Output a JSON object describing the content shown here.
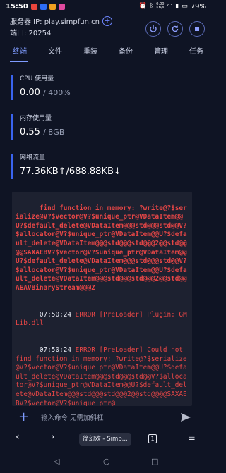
{
  "status_bar": {
    "time": "15:50",
    "net_speed": "0.00\nKB/s",
    "battery": "79%",
    "icon_colors": [
      "#e8453c",
      "#2d6cf5",
      "#f0a020",
      "#e04aa0"
    ]
  },
  "header": {
    "server_label": "服务器 IP: play.simpfun.cn",
    "port_label": "端口: 20254"
  },
  "tabs": [
    {
      "label": "终端",
      "active": true
    },
    {
      "label": "文件"
    },
    {
      "label": "重装"
    },
    {
      "label": "备份"
    },
    {
      "label": "管理"
    },
    {
      "label": "任务"
    }
  ],
  "metrics": {
    "cpu": {
      "title": "CPU 使用量",
      "value": "0.00",
      "limit": "/ 400%"
    },
    "memory": {
      "title": "内存使用量",
      "value": "0.55",
      "limit": "/ 8GB"
    },
    "network": {
      "title": "网络流量",
      "value": "77.36KB↑/688.88KB↓"
    }
  },
  "console": {
    "lines": [
      {
        "text": "find function in memory: ?write@?$serialize@V?$vector@V?$unique_ptr@VDataItem@@U?$default_delete@VDataItem@@@std@@@std@@V?$allocator@V?$unique_ptr@VDataItem@@U?$default_delete@VDataItem@@@std@@@std@@@2@@std@@@@SAXAEBV?$vector@V?$unique_ptr@VDataItem@@U?$default_delete@VDataItem@@@std@@@std@@V?$allocator@V?$unique_ptr@VDataItem@@U?$default_delete@VDataItem@@@std@@@std@@@2@@std@@AEAVBinaryStream@@@Z"
      },
      {
        "ts": "07:50:24",
        "text": " ERROR [PreLoader] Plugin: GMLib.dll"
      },
      {
        "ts": "07:50:24",
        "text": " ERROR [PreLoader] Could not find function in memory: ?write@?$serialize@V?$vector@V?$unique_ptr@VDataItem@@U?$default_delete@VDataItem@@@std@@@std@@V?$allocator@V?$unique_ptr@VDataItem@@U?$default_delete@VDataItem@@@std@@@std@@@2@@std@@@@SAXAEBV?$vector@V?$unique_ptr@"
      }
    ]
  },
  "input": {
    "placeholder": "输入命令 无需加斜杠"
  },
  "browser": {
    "tab_title": "简幻欢 - Simp...",
    "tab_count": "1"
  },
  "colors": {
    "accent": "#7f9cff",
    "error": "#e64646",
    "background": "#0f1424",
    "console_bg": "#1d2130"
  }
}
